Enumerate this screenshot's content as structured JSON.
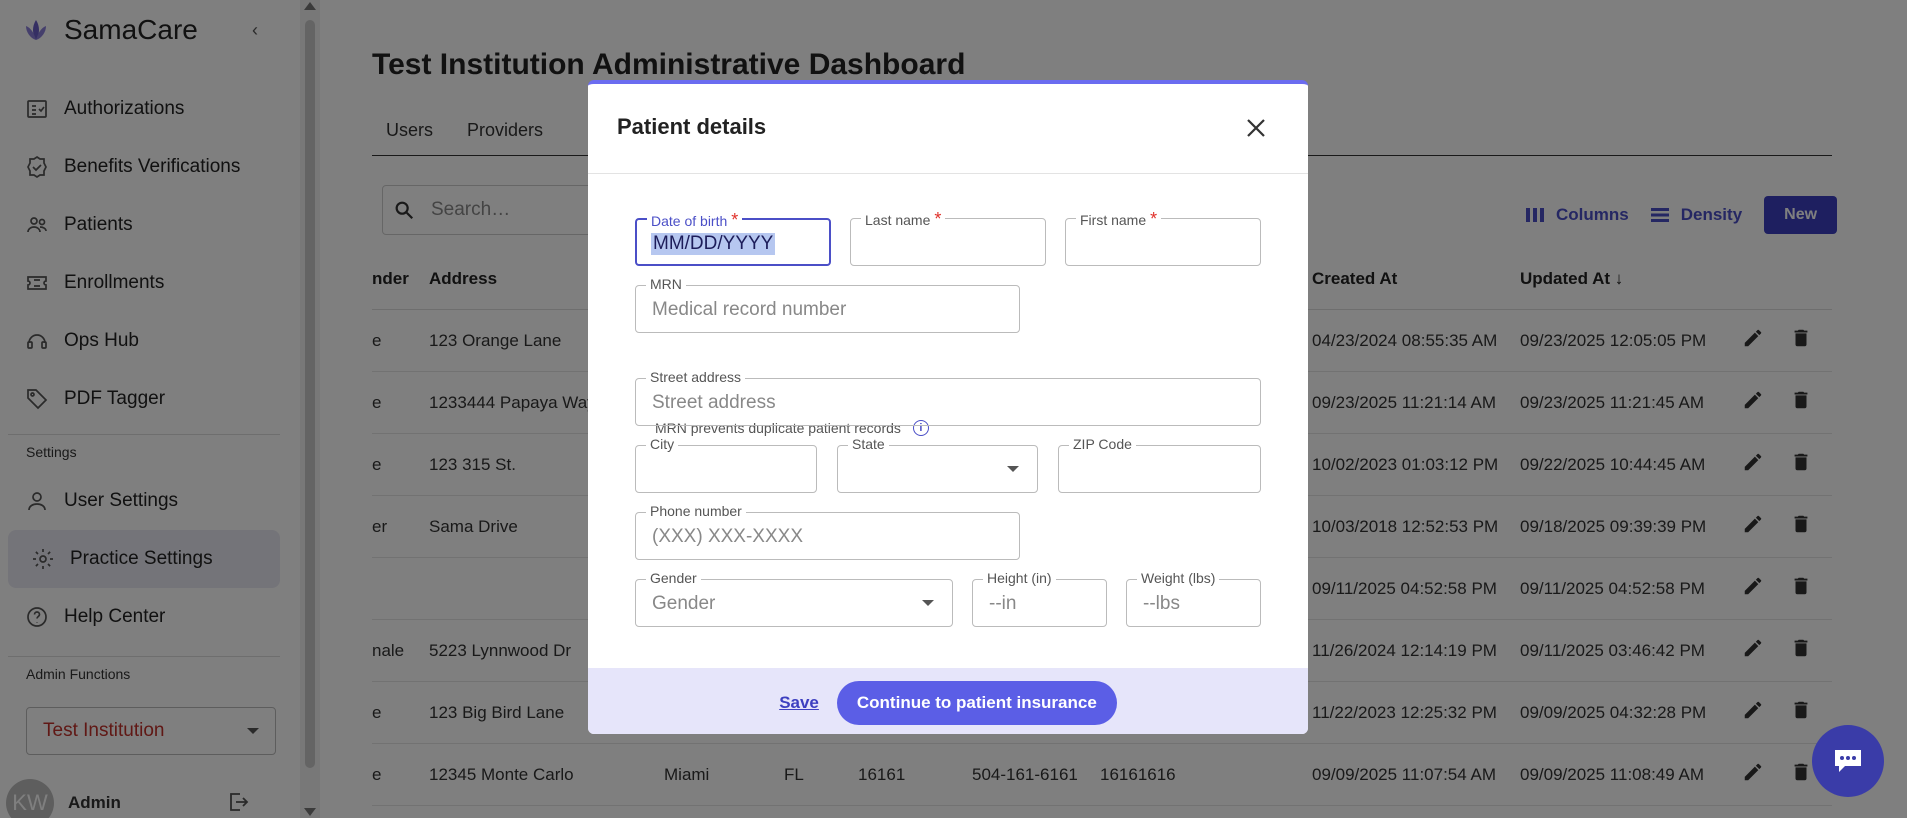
{
  "sidebar": {
    "brand": "SamaCare",
    "items": [
      {
        "label": "Authorizations",
        "icon": "authorizations-icon"
      },
      {
        "label": "Benefits Verifications",
        "icon": "badge-check-icon"
      },
      {
        "label": "Patients",
        "icon": "users-icon"
      },
      {
        "label": "Enrollments",
        "icon": "ticket-icon"
      },
      {
        "label": "Ops Hub",
        "icon": "headset-icon"
      },
      {
        "label": "PDF Tagger",
        "icon": "tag-icon"
      }
    ],
    "settings_label": "Settings",
    "settings_items": [
      {
        "label": "User Settings",
        "icon": "user-icon"
      },
      {
        "label": "Practice Settings",
        "icon": "gear-icon",
        "active": true
      },
      {
        "label": "Help Center",
        "icon": "help-icon"
      }
    ],
    "admin_label": "Admin Functions",
    "institution": "Test Institution",
    "user": {
      "initials": "KW",
      "name": "Admin"
    }
  },
  "main": {
    "title": "Test Institution Administrative Dashboard",
    "tabs": [
      "Users",
      "Providers"
    ],
    "search_placeholder": "Search…",
    "toolbar": {
      "columns": "Columns",
      "density": "Density",
      "new": "New"
    },
    "table": {
      "headers": {
        "gender": "nder",
        "address": "Address",
        "created": "Created At",
        "updated": "Updated At"
      },
      "rows": [
        {
          "gender": "e",
          "address": "123 Orange Lane",
          "city": "",
          "state": "",
          "zip": "",
          "phone": "",
          "mrn": "",
          "created": "04/23/2024 08:55:35 AM",
          "updated": "09/23/2025 12:05:05 PM"
        },
        {
          "gender": "e",
          "address": "1233444 Papaya Way",
          "city": "",
          "state": "",
          "zip": "",
          "phone": "",
          "mrn": "",
          "created": "09/23/2025 11:21:14 AM",
          "updated": "09/23/2025 11:21:45 AM"
        },
        {
          "gender": "e",
          "address": "123 315 St.",
          "city": "",
          "state": "",
          "zip": "",
          "phone": "",
          "mrn": "",
          "created": "10/02/2023 01:03:12 PM",
          "updated": "09/22/2025 10:44:45 AM"
        },
        {
          "gender": "er",
          "address": "Sama Drive",
          "city": "",
          "state": "",
          "zip": "",
          "phone": "",
          "mrn": "",
          "created": "10/03/2018 12:52:53 PM",
          "updated": "09/18/2025 09:39:39 PM"
        },
        {
          "gender": "",
          "address": "",
          "city": "",
          "state": "",
          "zip": "",
          "phone": "",
          "mrn": "",
          "created": "09/11/2025 04:52:58 PM",
          "updated": "09/11/2025 04:52:58 PM"
        },
        {
          "gender": "nale",
          "address": "5223 Lynnwood Dr",
          "city": "",
          "state": "",
          "zip": "",
          "phone": "",
          "mrn": "",
          "created": "11/26/2024 12:14:19 PM",
          "updated": "09/11/2025 03:46:42 PM"
        },
        {
          "gender": "e",
          "address": "123 Big Bird Lane",
          "city": "",
          "state": "",
          "zip": "",
          "phone": "",
          "mrn": "",
          "created": "11/22/2023 12:25:32 PM",
          "updated": "09/09/2025 04:32:28 PM"
        },
        {
          "gender": "e",
          "address": "12345 Monte Carlo",
          "city": "Miami",
          "state": "FL",
          "zip": "16161",
          "phone": "504-161-6161",
          "mrn": "16161616",
          "created": "09/09/2025 11:07:54 AM",
          "updated": "09/09/2025 11:08:49 AM"
        }
      ]
    }
  },
  "modal": {
    "title": "Patient details",
    "fields": {
      "dob": {
        "label": "Date of birth",
        "value": "MM/DD/YYYY"
      },
      "last_name": {
        "label": "Last name",
        "value": ""
      },
      "first_name": {
        "label": "First name",
        "value": ""
      },
      "mrn": {
        "label": "MRN",
        "placeholder": "Medical record number"
      },
      "mrn_helper": "MRN prevents duplicate patient records",
      "street": {
        "label": "Street address",
        "placeholder": "Street address"
      },
      "city": {
        "label": "City",
        "value": ""
      },
      "state": {
        "label": "State",
        "value": ""
      },
      "zip": {
        "label": "ZIP Code",
        "value": ""
      },
      "phone": {
        "label": "Phone number",
        "placeholder": "(XXX) XXX-XXXX"
      },
      "gender": {
        "label": "Gender",
        "placeholder": "Gender"
      },
      "height": {
        "label": "Height (in)",
        "placeholder": "--in"
      },
      "weight": {
        "label": "Weight (lbs)",
        "placeholder": "--lbs"
      }
    },
    "footer": {
      "save": "Save",
      "continue": "Continue to patient insurance"
    }
  },
  "colors": {
    "accent": "#4b4fc7",
    "required": "#e0312a",
    "footer_bg": "#e6e5fa"
  }
}
